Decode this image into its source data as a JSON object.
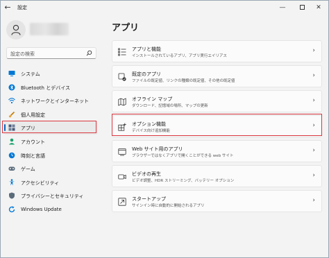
{
  "window": {
    "title": "設定",
    "back_glyph": "←",
    "min_glyph": "—",
    "close_glyph": "✕"
  },
  "search": {
    "placeholder": "設定の検索"
  },
  "sidebar": {
    "items": [
      {
        "label": "システム",
        "icon": "monitor-icon",
        "color": "#0078d4"
      },
      {
        "label": "Bluetooth とデバイス",
        "icon": "bluetooth-icon",
        "color": "#0078d4"
      },
      {
        "label": "ネットワークとインターネット",
        "icon": "network-icon",
        "color": "#0078d4"
      },
      {
        "label": "個人用設定",
        "icon": "brush-icon",
        "color": "#c57b00"
      },
      {
        "label": "アプリ",
        "icon": "apps-icon",
        "color": "#4a5a7a"
      },
      {
        "label": "アカウント",
        "icon": "account-icon",
        "color": "#1aa06b"
      },
      {
        "label": "時刻と言語",
        "icon": "globe-clock-icon",
        "color": "#0078d4"
      },
      {
        "label": "ゲーム",
        "icon": "gamepad-icon",
        "color": "#5a6b7a"
      },
      {
        "label": "アクセシビリティ",
        "icon": "accessibility-icon",
        "color": "#0078d4"
      },
      {
        "label": "プライバシーとセキュリティ",
        "icon": "shield-icon",
        "color": "#5a6b7a"
      },
      {
        "label": "Windows Update",
        "icon": "update-icon",
        "color": "#0078d4"
      }
    ],
    "active_index": 4
  },
  "main": {
    "title": "アプリ",
    "cards": [
      {
        "title": "アプリと機能",
        "subtitle": "インストールされているアプリ、アプリ実行エイリアス",
        "icon": "list-icon"
      },
      {
        "title": "既定のアプリ",
        "subtitle": "ファイルの既定値、リンクの種類の既定値、その他の既定値",
        "icon": "default-apps-icon"
      },
      {
        "title": "オフライン マップ",
        "subtitle": "ダウンロード、記憶域の場所、マップの更新",
        "icon": "map-icon"
      },
      {
        "title": "オプション機能",
        "subtitle": "デバイス向け追加機能",
        "icon": "optional-features-icon"
      },
      {
        "title": "Web サイト用のアプリ",
        "subtitle": "ブラウザーではなくアプリで開くことができる web サイト",
        "icon": "web-app-icon"
      },
      {
        "title": "ビデオの再生",
        "subtitle": "ビデオ調整、HDR ストリーミング、バッテリー オプション",
        "icon": "video-icon"
      },
      {
        "title": "スタートアップ",
        "subtitle": "サインイン時に自動的に開始されるアプリ",
        "icon": "startup-icon"
      }
    ],
    "chevron_glyph": "›",
    "highlighted_index": 3
  },
  "colors": {
    "accent": "#0067c0",
    "highlight_box": "#d9363e"
  }
}
